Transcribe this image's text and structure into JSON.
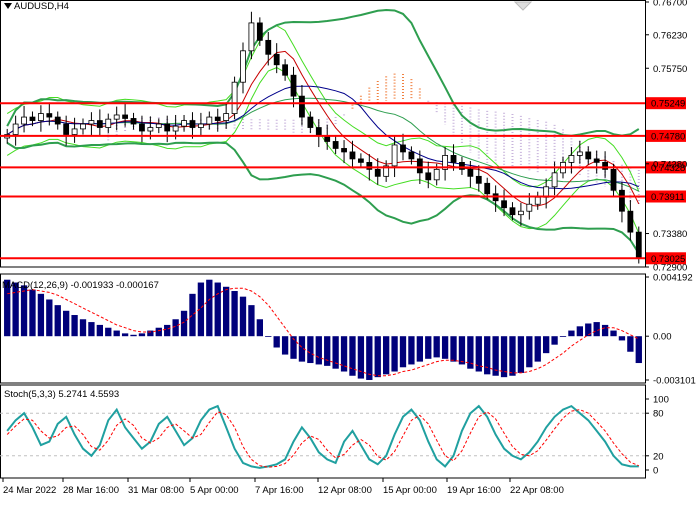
{
  "colors": {
    "background": "#ffffff",
    "candle_up": "#000000",
    "candle_down": "#000000",
    "level_line": "#ff0000",
    "level_label_bg": "#ff0000",
    "level_label_text": "#ffffff",
    "bb": "#2e9e4f",
    "ma_red": "#c80000",
    "ma_blue": "#00008b",
    "env_green": "#44dd22",
    "cloud_orange": "#f08040",
    "cloud_lavender": "#c8b4dc",
    "macd_hist": "#00007a",
    "macd_signal": "#ff0000",
    "stoch_main": "#20a0a0",
    "stoch_signal": "#ff0000",
    "stoch_level": "#c0c0c0"
  },
  "chart_data": [
    {
      "type": "candlestick",
      "title": "AUDUSD,H4",
      "y_ticks": [
        "0.76700",
        "0.76230",
        "0.75750",
        "0.74380",
        "0.73380",
        "0.72900"
      ],
      "ylim": [
        0.729,
        0.767
      ],
      "levels": [
        {
          "value": 0.75249,
          "label": "0.75249"
        },
        {
          "value": 0.7478,
          "label": "0.74780"
        },
        {
          "value": 0.74328,
          "label": "0.74328"
        },
        {
          "value": 0.73911,
          "label": "0.73911"
        },
        {
          "value": 0.73025,
          "label": "0.73025"
        }
      ],
      "x_labels": [
        "24 Mar 2022",
        "28 Mar 16:00",
        "31 Mar 08:00",
        "5 Apr 00:00",
        "7 Apr 16:00",
        "12 Apr 08:00",
        "15 Apr 00:00",
        "19 Apr 16:00",
        "22 Apr 08:00"
      ],
      "close": [
        0.748,
        0.7495,
        0.7505,
        0.75,
        0.751,
        0.7505,
        0.7495,
        0.748,
        0.7488,
        0.7495,
        0.75,
        0.749,
        0.7502,
        0.7508,
        0.7503,
        0.7495,
        0.7485,
        0.749,
        0.7495,
        0.7485,
        0.7492,
        0.75,
        0.749,
        0.7495,
        0.7505,
        0.75,
        0.751,
        0.7555,
        0.76,
        0.764,
        0.7615,
        0.7595,
        0.758,
        0.7565,
        0.7535,
        0.7505,
        0.749,
        0.7478,
        0.747,
        0.746,
        0.7455,
        0.7445,
        0.744,
        0.743,
        0.742,
        0.7435,
        0.7465,
        0.7455,
        0.7445,
        0.7425,
        0.7415,
        0.743,
        0.745,
        0.744,
        0.743,
        0.742,
        0.741,
        0.7395,
        0.7385,
        0.7375,
        0.7365,
        0.737,
        0.738,
        0.739,
        0.7405,
        0.7425,
        0.744,
        0.745,
        0.7455,
        0.7445,
        0.744,
        0.743,
        0.74,
        0.737,
        0.734,
        0.7303
      ],
      "indicators": [
        "Bollinger Bands",
        "Moving Average",
        "Moving Average",
        "Envelopes",
        "Ichimoku Cloud"
      ]
    },
    {
      "type": "bar",
      "title": "MACD(12,26,9) -0.001933 -0.000167",
      "y_ticks": [
        "0.004192",
        "0.00",
        "-0.003101"
      ],
      "ylim": [
        -0.003101,
        0.004192
      ],
      "series": [
        {
          "name": "MACD",
          "values": [
            0.004,
            0.0038,
            0.0036,
            0.0033,
            0.003,
            0.0026,
            0.0022,
            0.0018,
            0.0015,
            0.0012,
            0.001,
            0.0008,
            0.0006,
            0.0004,
            0.0002,
            0.0001,
            0.0002,
            0.0004,
            0.0006,
            0.0008,
            0.0012,
            0.0018,
            0.003,
            0.0038,
            0.004,
            0.0038,
            0.0035,
            0.0032,
            0.0028,
            0.0022,
            0.0012,
            0.0,
            -0.0008,
            -0.0013,
            -0.0016,
            -0.0018,
            -0.0019,
            -0.002,
            -0.0021,
            -0.0023,
            -0.0025,
            -0.0028,
            -0.003,
            -0.0031,
            -0.0029,
            -0.0027,
            -0.0025,
            -0.0022,
            -0.002,
            -0.0018,
            -0.0016,
            -0.0015,
            -0.0016,
            -0.0018,
            -0.002,
            -0.0023,
            -0.0025,
            -0.0027,
            -0.0028,
            -0.0029,
            -0.0028,
            -0.0026,
            -0.0022,
            -0.0018,
            -0.0012,
            -0.0006,
            0.0,
            0.0004,
            0.0007,
            0.0009,
            0.001,
            0.0008,
            0.0004,
            -0.0003,
            -0.0011,
            -0.0019
          ]
        },
        {
          "values": [
            0.003,
            0.0031,
            0.0032,
            0.0033,
            0.0032,
            0.0031,
            0.0029,
            0.0026,
            0.0023,
            0.002,
            0.0017,
            0.0014,
            0.0011,
            0.0008,
            0.0006,
            0.0004,
            0.0003,
            0.0003,
            0.0004,
            0.0005,
            0.0007,
            0.001,
            0.0015,
            0.002,
            0.0026,
            0.003,
            0.0033,
            0.0034,
            0.0034,
            0.0032,
            0.0028,
            0.0022,
            0.0014,
            0.0006,
            -0.0002,
            -0.0008,
            -0.0012,
            -0.0015,
            -0.0017,
            -0.0019,
            -0.0021,
            -0.0023,
            -0.0025,
            -0.0027,
            -0.0028,
            -0.0028,
            -0.0027,
            -0.0025,
            -0.0024,
            -0.0022,
            -0.002,
            -0.0018,
            -0.0017,
            -0.0017,
            -0.0018,
            -0.0019,
            -0.0021,
            -0.0022,
            -0.0024,
            -0.0025,
            -0.0026,
            -0.0026,
            -0.0025,
            -0.0023,
            -0.002,
            -0.0016,
            -0.0012,
            -0.0007,
            -0.0003,
            0.0001,
            0.0004,
            0.0006,
            0.0006,
            0.0004,
            0.0001,
            -0.0002
          ]
        }
      ]
    },
    {
      "type": "line",
      "title": "Stoch(5,3,3) 5.2741 4.5593",
      "y_ticks": [
        "100",
        "80",
        "20",
        "0"
      ],
      "ylim": [
        0,
        100
      ],
      "levels": [
        80,
        20
      ],
      "series": [
        {
          "name": "Stoch",
          "values": [
            55,
            70,
            80,
            60,
            35,
            40,
            65,
            75,
            50,
            30,
            20,
            35,
            70,
            85,
            60,
            45,
            30,
            40,
            65,
            75,
            55,
            35,
            45,
            70,
            85,
            90,
            60,
            30,
            10,
            5,
            3,
            5,
            8,
            15,
            40,
            60,
            45,
            25,
            15,
            10,
            40,
            55,
            35,
            15,
            8,
            20,
            50,
            75,
            85,
            70,
            40,
            15,
            5,
            20,
            55,
            80,
            90,
            75,
            50,
            30,
            20,
            15,
            25,
            40,
            60,
            75,
            85,
            90,
            80,
            70,
            55,
            40,
            20,
            8,
            5,
            5
          ]
        },
        {
          "values": [
            50,
            62,
            72,
            70,
            55,
            45,
            48,
            60,
            62,
            50,
            33,
            28,
            42,
            63,
            72,
            63,
            45,
            38,
            45,
            60,
            65,
            55,
            45,
            50,
            67,
            82,
            78,
            60,
            33,
            15,
            6,
            4,
            5,
            9,
            21,
            38,
            48,
            43,
            28,
            17,
            22,
            35,
            43,
            35,
            19,
            14,
            26,
            48,
            70,
            77,
            65,
            42,
            20,
            13,
            27,
            52,
            75,
            82,
            72,
            52,
            33,
            22,
            20,
            27,
            42,
            58,
            73,
            83,
            85,
            80,
            68,
            55,
            38,
            23,
            11,
            6
          ]
        }
      ]
    }
  ]
}
